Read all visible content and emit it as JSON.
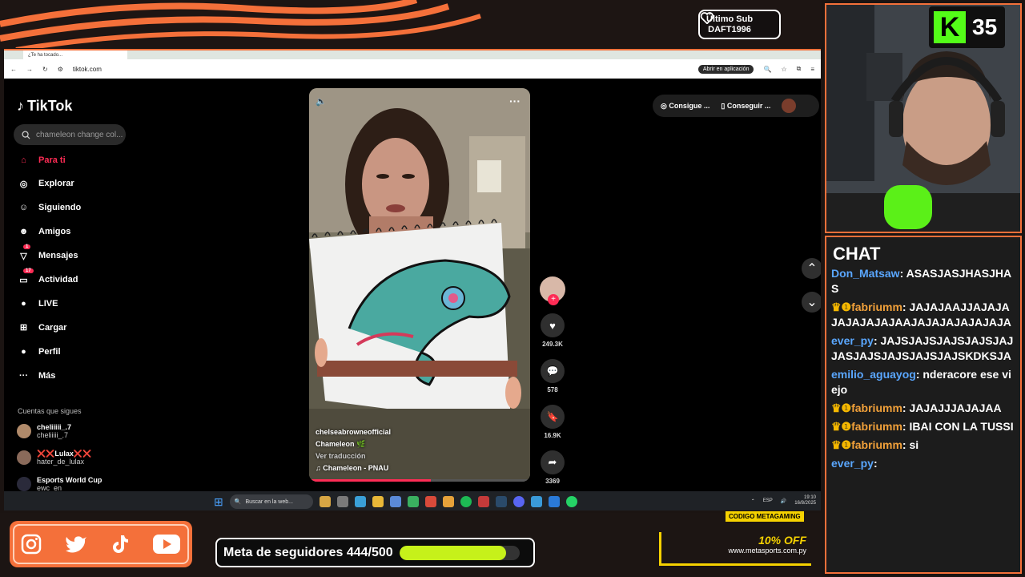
{
  "overlay": {
    "sub_badge_title": "Último Sub",
    "sub_badge_name": "DAFT1996",
    "kick_viewers": "35",
    "accent": "#f4703a"
  },
  "browser": {
    "tab_title": "¿Te ha tocado...",
    "url": "tiktok.com",
    "open_app": "Abrir en aplicación"
  },
  "tiktok": {
    "logo": "TikTok",
    "search_placeholder": "chameleon change col...",
    "nav": [
      {
        "label": "Para ti",
        "icon": "home-icon",
        "active": true
      },
      {
        "label": "Explorar",
        "icon": "compass-icon"
      },
      {
        "label": "Siguiendo",
        "icon": "following-icon"
      },
      {
        "label": "Amigos",
        "icon": "friends-icon"
      },
      {
        "label": "Mensajes",
        "icon": "messages-icon",
        "badge": "1"
      },
      {
        "label": "Actividad",
        "icon": "activity-icon",
        "badge": "17"
      },
      {
        "label": "LIVE",
        "icon": "live-icon"
      },
      {
        "label": "Cargar",
        "icon": "upload-icon"
      },
      {
        "label": "Perfil",
        "icon": "profile-icon"
      },
      {
        "label": "Más",
        "icon": "more-icon"
      }
    ],
    "follows_title": "Cuentas que sigues",
    "follows": [
      {
        "name": "cheliiiii_.7",
        "handle": "cheliiiii_.7"
      },
      {
        "name": "❌❌Lulax❌❌",
        "handle": "hater_de_lulax"
      },
      {
        "name": "Esports World Cup",
        "handle": "ewc_en"
      }
    ],
    "topright": {
      "coins": "Consigue ...",
      "app": "Conseguir ..."
    },
    "video": {
      "author": "chelseabrowneofficial",
      "caption": "Chameleon 🌿",
      "translate": "Ver traducción",
      "music": "♫ Chameleon - PNAU",
      "progress": 0.55
    },
    "actions": {
      "likes": "249.3K",
      "comments": "578",
      "saves": "16.9K",
      "shares": "3369"
    }
  },
  "taskbar": {
    "search": "Buscar en la web...",
    "lang": "ESP",
    "time": "19:10",
    "date": "16/8/2025"
  },
  "chat": {
    "title": "CHAT",
    "messages": [
      {
        "user": "Don_Matsaw",
        "text": "ASASJASJHASJHAS",
        "color": "blue",
        "crown": false
      },
      {
        "user": "fabriumm",
        "text": "JAJAJAAJJAJAJAJAJAJAJAJAAJAJAJAJAJAJAJA",
        "color": "orange",
        "crown": true
      },
      {
        "user": "ever_py",
        "text": "JAJSJAJSJAJSJAJSJAJJASJAJSJAJSJAJSJAJSKDKSJA",
        "color": "blue",
        "crown": false
      },
      {
        "user": "emilio_aguayog",
        "text": "nderacore ese viejo",
        "color": "blue",
        "crown": false
      },
      {
        "user": "fabriumm",
        "text": "JAJAJJJAJAJAA",
        "color": "orange",
        "crown": true
      },
      {
        "user": "fabriumm",
        "text": "IBAI CON LA TUSSI",
        "color": "orange",
        "crown": true
      },
      {
        "user": "fabriumm",
        "text": "si",
        "color": "orange",
        "crown": true
      },
      {
        "user": "ever_py",
        "text": "",
        "color": "blue",
        "crown": false
      }
    ]
  },
  "bottom": {
    "goal_label": "Meta de seguidores 444/500",
    "goal_fraction": 0.888,
    "ad_code": "CODIGO METAGAMING",
    "ad_off": "10% OFF",
    "ad_site": "www.metasports.com.py"
  }
}
